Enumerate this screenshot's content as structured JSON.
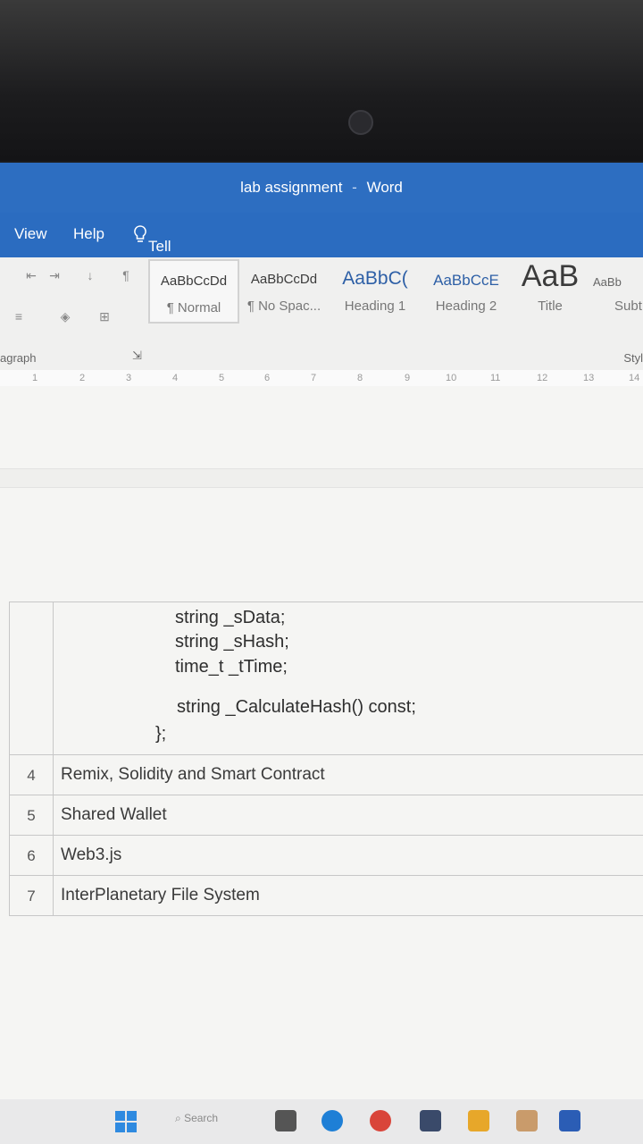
{
  "window": {
    "title": "lab assignment",
    "app": "Word",
    "separator": "-"
  },
  "menu": {
    "view": "View",
    "help": "Help",
    "tell_me": "Tell me what you want to do"
  },
  "styles": [
    {
      "sample": "AaBbCcDd",
      "name": "¶ Normal"
    },
    {
      "sample": "AaBbCcDd",
      "name": "¶ No Spac..."
    },
    {
      "sample": "AaBbC(",
      "name": "Heading 1"
    },
    {
      "sample": "AaBbCcE",
      "name": "Heading 2"
    },
    {
      "sample": "AaB",
      "name": "Title"
    },
    {
      "sample": "AaBb",
      "name": "Subt"
    }
  ],
  "groups": {
    "paragraph": "agraph",
    "styles": "Styl"
  },
  "ruler": [
    "1",
    "2",
    "3",
    "4",
    "5",
    "6",
    "7",
    "8",
    "9",
    "10",
    "11",
    "12",
    "13",
    "14"
  ],
  "code": {
    "line1": "string _sData;",
    "line2": "string _sHash;",
    "line3": "time_t _tTime;",
    "line4": "string _CalculateHash() const;",
    "line5": "};"
  },
  "rows": [
    {
      "num": "4",
      "topic": "Remix, Solidity and Smart Contract"
    },
    {
      "num": "5",
      "topic": "Shared Wallet"
    },
    {
      "num": "6",
      "topic": "Web3.js"
    },
    {
      "num": "7",
      "topic": "InterPlanetary File System"
    }
  ],
  "taskbar": {
    "search": "Search"
  },
  "colors": {
    "title_bar": "#2d6ec1",
    "ribbon": "#f0f0ef",
    "page": "#f5f5f3"
  }
}
